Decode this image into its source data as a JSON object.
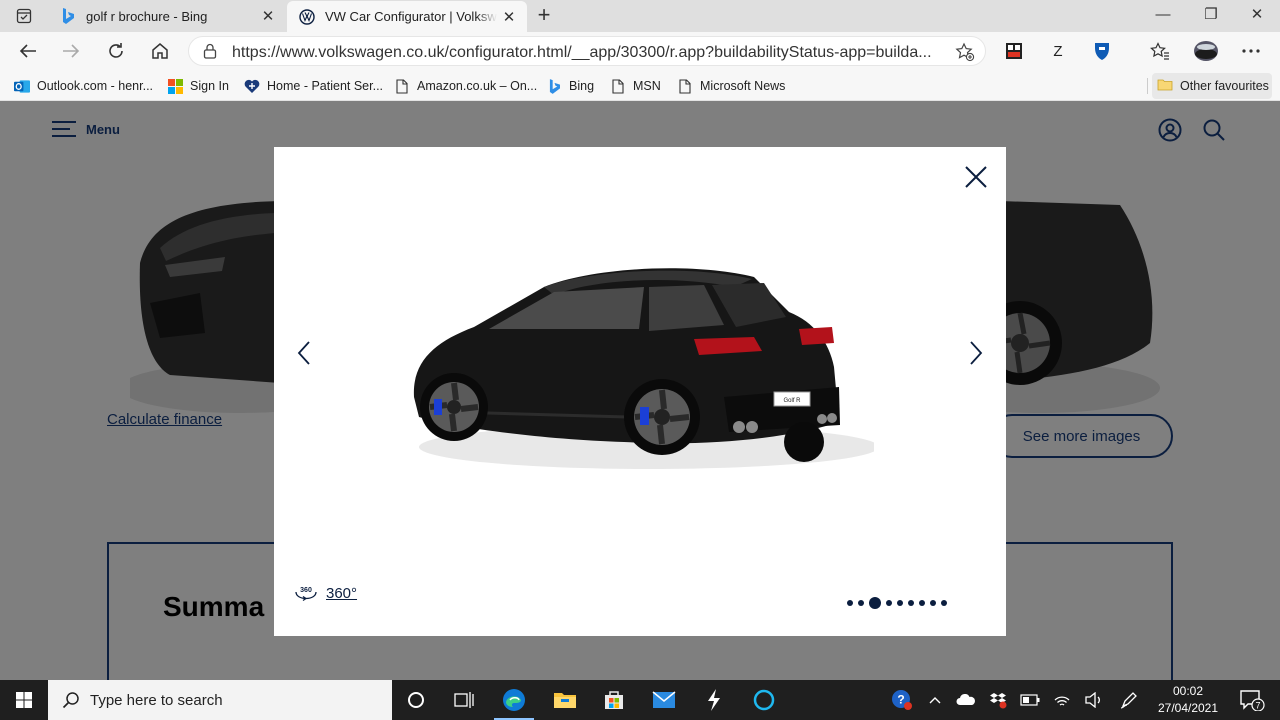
{
  "browser": {
    "tabs": [
      {
        "title": "golf r brochure - Bing",
        "close": "✕"
      },
      {
        "title": "VW Car Configurator | Volkswagen",
        "close": "✕"
      }
    ],
    "new_tab": "+",
    "window_controls": {
      "minimize": "—",
      "restore": "❐",
      "close": "✕"
    },
    "address_url": "https://www.volkswagen.co.uk/configurator.html/__app/30300/r.app?buildabilityStatus-app=builda...",
    "extensions": {
      "z_label": "Z"
    },
    "favourites": [
      {
        "label": "Outlook.com - henr...",
        "icon": "outlook-icon"
      },
      {
        "label": "Sign In",
        "icon": "microsoft-icon"
      },
      {
        "label": "Home - Patient Ser...",
        "icon": "heart-icon"
      },
      {
        "label": "Amazon.co.uk – On...",
        "icon": "page-icon"
      },
      {
        "label": "Bing",
        "icon": "bing-icon"
      },
      {
        "label": "MSN",
        "icon": "page-icon"
      },
      {
        "label": "Microsoft News",
        "icon": "page-icon"
      }
    ],
    "other_favourites": "Other favourites"
  },
  "page": {
    "menu_label": "Menu",
    "calculate_finance": "Calculate finance",
    "see_more_images": "See more images",
    "summary_title": "Summa"
  },
  "modal": {
    "view360_label": "360°",
    "view360_icon_text": "360",
    "plate_text": "Golf R",
    "dots_total": 9,
    "dots_active_index": 2
  },
  "taskbar": {
    "search_placeholder": "Type here to search",
    "time": "00:02",
    "date": "27/04/2021",
    "notification_count": "7"
  },
  "colors": {
    "vw_navy": "#0b1e3f",
    "overlay_gray": "#7f7f7f",
    "taskbar": "#1f1f1f",
    "edge_blue": "#0078d4"
  }
}
